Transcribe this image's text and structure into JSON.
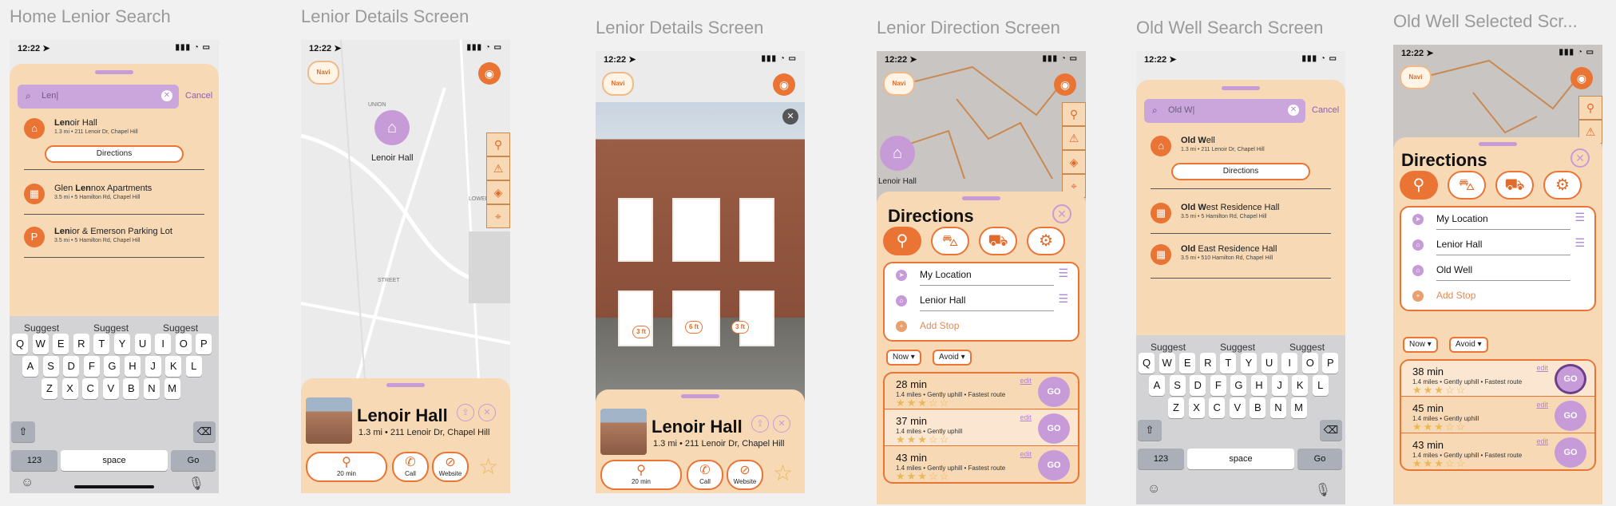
{
  "frames": [
    {
      "title": "Home Lenior Search"
    },
    {
      "title": "Lenior Details Screen"
    },
    {
      "title": "Lenior Details Screen"
    },
    {
      "title": "Lenior Direction Screen"
    },
    {
      "title": "Old Well Search Screen"
    },
    {
      "title": "Old Well Selected Scr..."
    }
  ],
  "status": {
    "time": "12:22",
    "icons": "▮▮▮ ◔ ▭"
  },
  "search1": {
    "query": "Len|",
    "cancel": "Cancel",
    "results": [
      {
        "bold": "Len",
        "rest": "oir Hall",
        "sub": "1.3 mi  •  211 Lenoir Dr, Chapel Hill"
      },
      {
        "pre": "Glen ",
        "bold": "Len",
        "rest": "nox Apartments",
        "sub": "3.5 mi  •  5 Hamilton Rd, Chapel Hill"
      },
      {
        "bold": "Len",
        "rest": "ior & Emerson Parking Lot",
        "sub": "3.5 mi  •  5 Hamilton Rd, Chapel Hill"
      }
    ],
    "directions": "Directions"
  },
  "search2": {
    "query": "Old W|",
    "cancel": "Cancel",
    "results": [
      {
        "bold": "Old W",
        "rest": "ell",
        "sub": "1.3 mi  •  211 Lenoir Dr, Chapel Hill"
      },
      {
        "bold": "Old W",
        "rest": "est Residence Hall",
        "sub": "3.5 mi  •  5 Hamilton Rd, Chapel Hill"
      },
      {
        "bold": "Old",
        "rest": " East Residence Hall",
        "sub": "3.5 mi  •  510 Hamilton Rd, Chapel Hill"
      }
    ],
    "directions": "Directions"
  },
  "keyboard": {
    "suggest": [
      "Suggest",
      "Suggest",
      "Suggest"
    ],
    "row1": [
      "Q",
      "W",
      "E",
      "R",
      "T",
      "Y",
      "U",
      "I",
      "O",
      "P"
    ],
    "row2": [
      "A",
      "S",
      "D",
      "F",
      "G",
      "H",
      "J",
      "K",
      "L"
    ],
    "row3": [
      "Z",
      "X",
      "C",
      "V",
      "B",
      "N",
      "M"
    ],
    "num": "123",
    "space": "space",
    "go": "Go"
  },
  "logo": "Navi",
  "map_labels": {
    "union": "UNION",
    "street": "STREET",
    "lower": "LOWER",
    "lenoir": "Lenoir Hall"
  },
  "details": {
    "title": "Lenoir Hall",
    "sub": "1.3 mi  •  211 Lenoir Dr, Chapel Hill",
    "walk": "20 min",
    "call": "Call",
    "website": "Website",
    "measure": [
      "3 ft",
      "6 ft",
      "3 ft"
    ]
  },
  "directions": {
    "title": "Directions",
    "stops_a": [
      "My Location",
      "Lenior Hall"
    ],
    "stops_b": [
      "My Location",
      "Lenior Hall",
      "Old Well"
    ],
    "add_stop": "Add Stop",
    "now": "Now",
    "avoid": "Avoid",
    "routes_a": [
      {
        "time": "28 min",
        "desc": "1.4 miles • Gently uphill • Fastest route",
        "edit": "edit",
        "go": "GO"
      },
      {
        "time": "37 min",
        "desc": "1.4 miles • Gently uphill",
        "edit": "edit",
        "go": "GO"
      },
      {
        "time": "43 min",
        "desc": "1.4 miles • Gently uphill • Fastest route",
        "edit": "edit",
        "go": "GO"
      }
    ],
    "routes_b": [
      {
        "time": "38 min",
        "desc": "1.4 miles • Gently uphill • Fastest route",
        "edit": "edit",
        "go": "GO"
      },
      {
        "time": "45 min",
        "desc": "1.4 miles • Gently uphill",
        "edit": "edit",
        "go": "GO"
      },
      {
        "time": "43 min",
        "desc": "1.4 miles • Gently uphill • Fastest route",
        "edit": "edit",
        "go": "GO"
      }
    ],
    "stars": "★★★☆☆"
  }
}
